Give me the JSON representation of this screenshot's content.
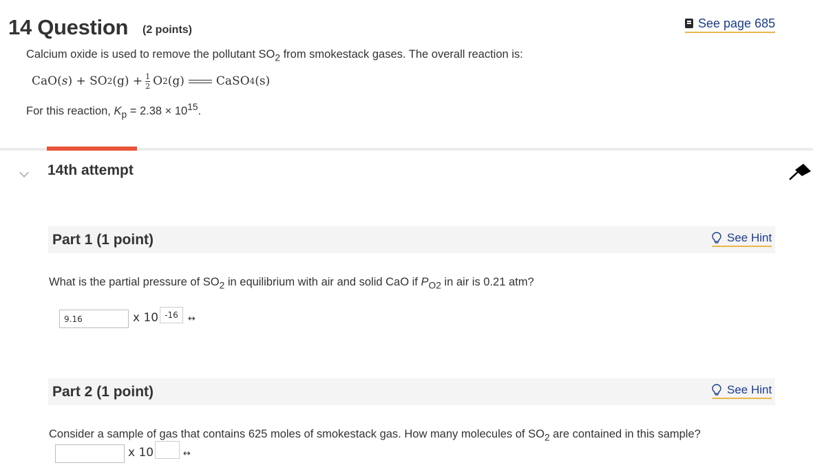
{
  "question": {
    "number_title": "14 Question",
    "points": "(2 points)",
    "page_link": "See page 685",
    "intro": "Calcium oxide is used to remove the pollutant SO",
    "intro_sub": "2",
    "intro_end": " from smokestack gases. The overall reaction is:",
    "equation": {
      "cao": "CaO(",
      "s1": "s",
      "close1": ") + SO",
      "so2_sub": "2",
      "g1": "(g) + ",
      "frac_num": "1",
      "frac_den": "2",
      "o2": "O",
      "o2_sub": "2",
      "g2": "(g)",
      "caso4": "CaSO",
      "caso4_sub": "4",
      "s2": "(s)"
    },
    "kp_prefix": "For this reaction, ",
    "kp_symbol": "K",
    "kp_sub": "p",
    "kp_value": " = 2.38 × 10",
    "kp_exp": "15",
    "kp_end": "."
  },
  "attempt": {
    "label": "14th attempt"
  },
  "parts": [
    {
      "label": "Part 1   (1 point)",
      "hint": "See Hint",
      "prompt_a": "What is the partial pressure of SO",
      "prompt_sub": "2",
      "prompt_b": " in equilibrium with air and solid CaO if ",
      "prompt_p": "P",
      "prompt_p_sub": "O2",
      "prompt_c": " in air is 0.21 atm?",
      "answer_value": "9.16",
      "times_ten": "x 10",
      "exponent_value": "-16",
      "toggle": "↔"
    },
    {
      "label": "Part 2   (1 point)",
      "hint": "See Hint",
      "prompt_a": "Consider a sample of gas that contains 625  moles of smokestack gas. How many molecules of SO",
      "prompt_sub": "2",
      "prompt_b": " are contained in this sample?",
      "answer_value": "",
      "times_ten": "x 10",
      "exponent_value": "",
      "toggle": "↔"
    }
  ],
  "colors": {
    "accent": "#e8553a",
    "link": "#1a3c8c",
    "underline": "#e8b74a"
  }
}
